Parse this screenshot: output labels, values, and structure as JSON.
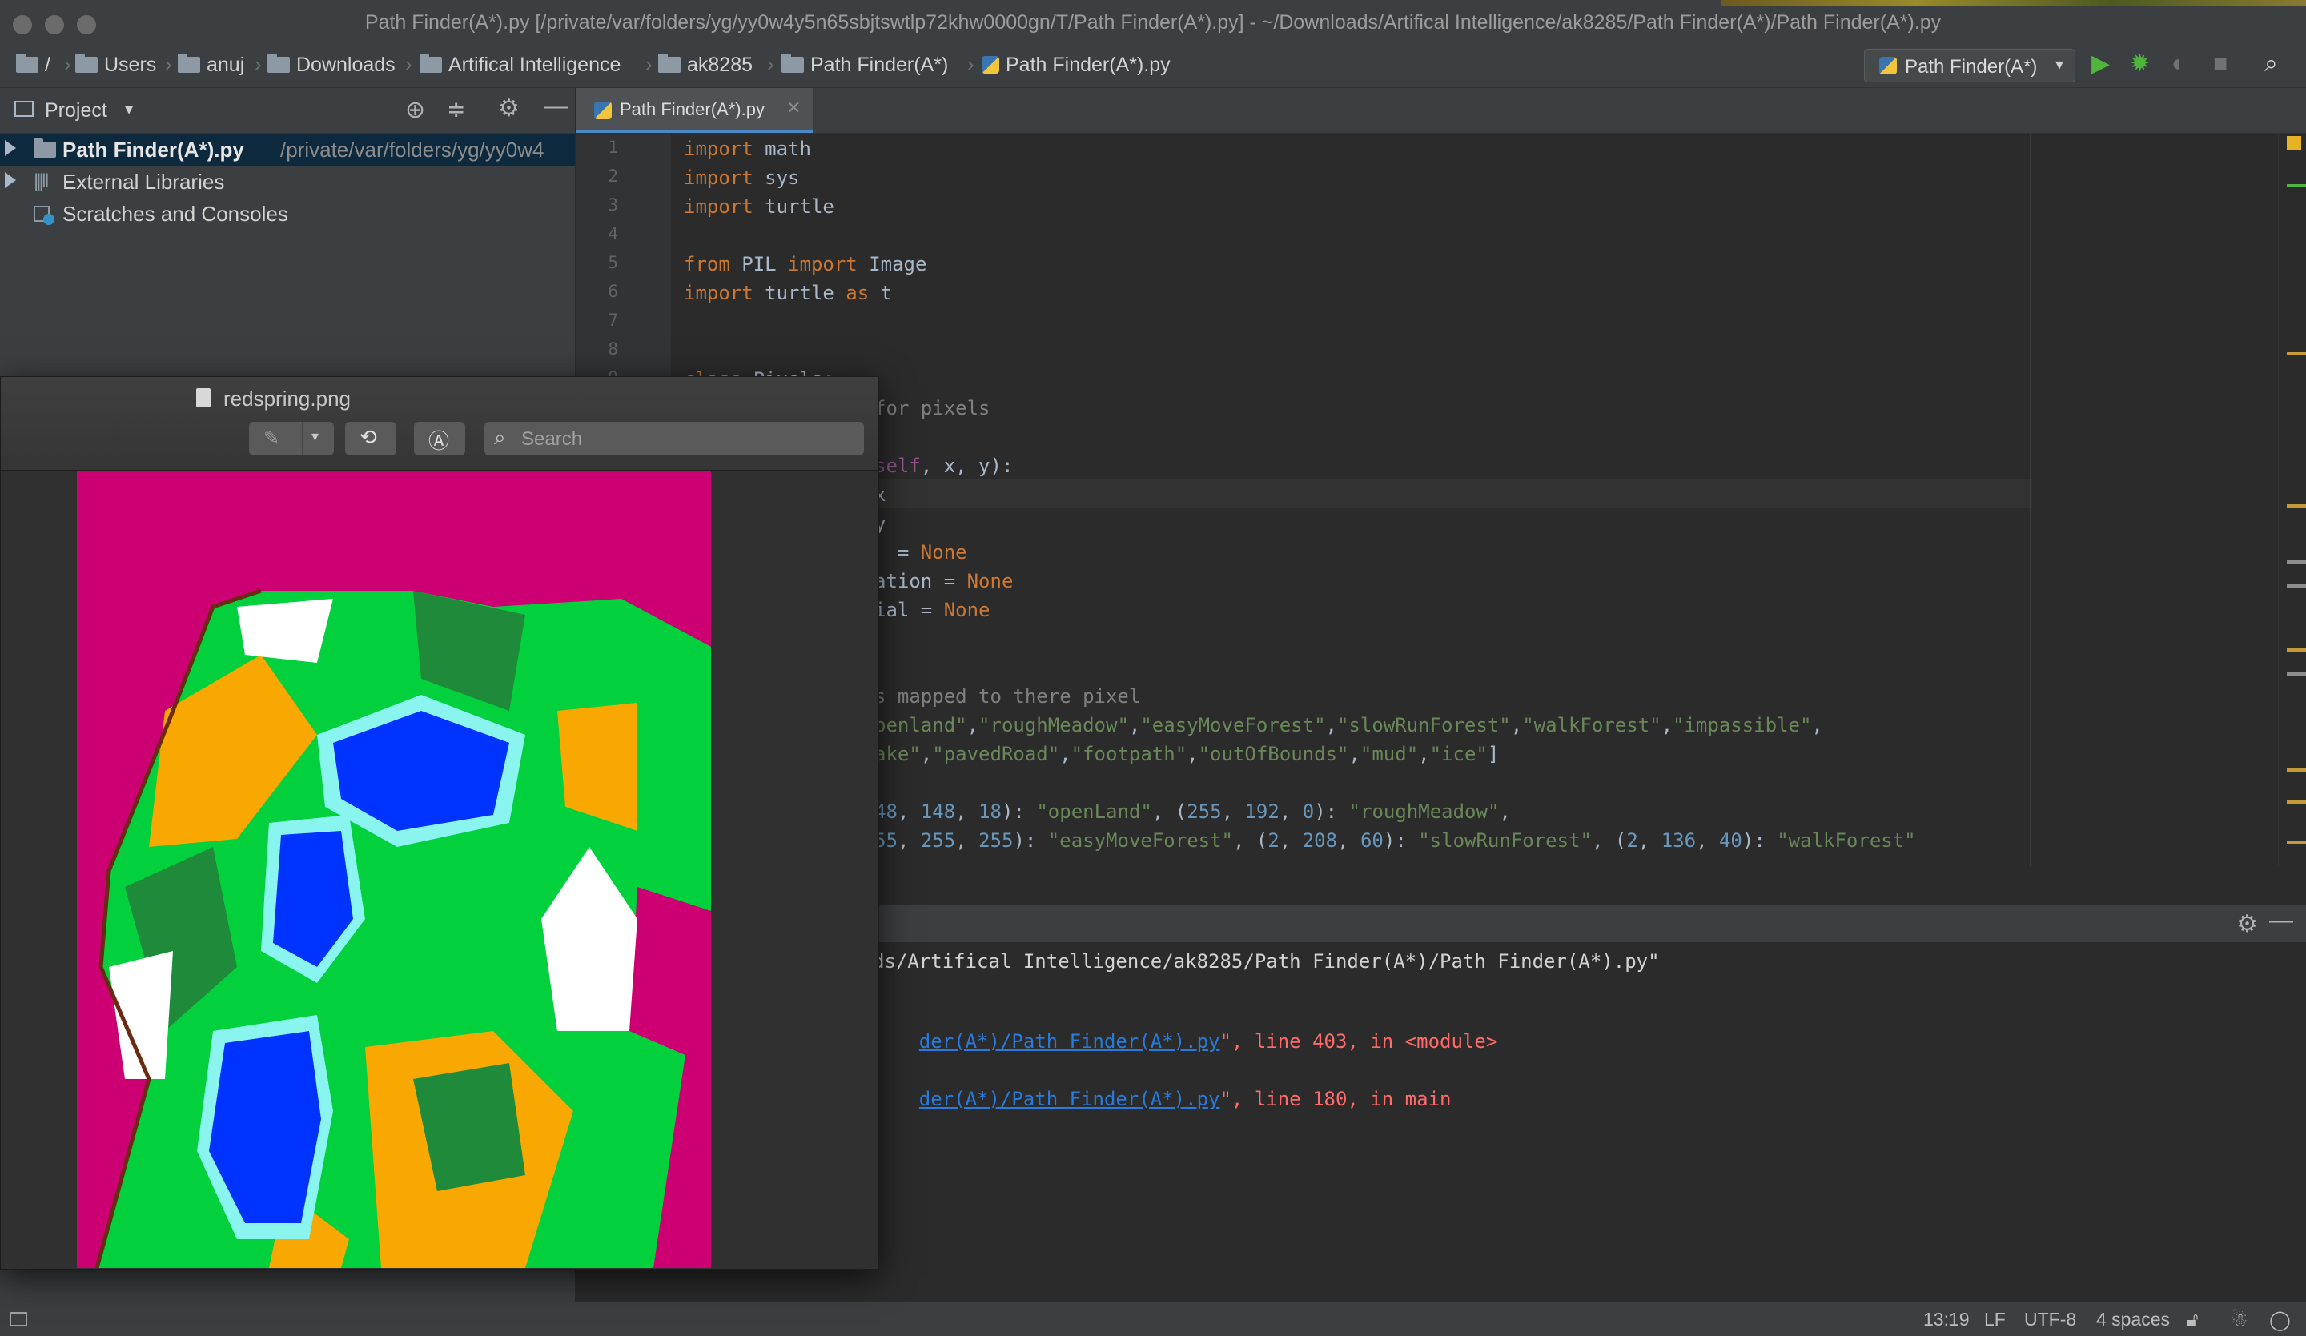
{
  "window": {
    "title": "Path Finder(A*).py [/private/var/folders/yg/yy0w4y5n65sbjtswtlp72khw0000gn/T/Path Finder(A*).py] - ~/Downloads/Artifical Intelligence/ak8285/Path Finder(A*)/Path Finder(A*).py"
  },
  "breadcrumbs": {
    "root": "/",
    "items": [
      "Users",
      "anuj",
      "Downloads",
      "Artifical Intelligence",
      "ak8285",
      "Path Finder(A*)",
      "Path Finder(A*).py"
    ]
  },
  "toolbar": {
    "run_config": "Path Finder(A*)",
    "icons": [
      "run-icon",
      "debug-icon",
      "coverage-icon",
      "stop-icon",
      "search-icon"
    ]
  },
  "project_panel": {
    "title": "Project",
    "tree": [
      {
        "label": "Path Finder(A*).py",
        "path": "/private/var/folders/yg/yy0w4"
      },
      {
        "label": "External Libraries"
      },
      {
        "label": "Scratches and Consoles"
      }
    ]
  },
  "editor": {
    "tab": "Path Finder(A*).py",
    "line_numbers": [
      "1",
      "2",
      "3",
      "4",
      "5",
      "6",
      "7",
      "8",
      "9"
    ]
  },
  "image_viewer": {
    "filename": "redspring.png",
    "search_placeholder": "Search",
    "colors": {
      "out_of_bounds": "#cd0073",
      "water": "#0033ff",
      "ice": "#8af5ef",
      "forest_light": "#ffffff",
      "forest_walk": "#1e8a3a",
      "slow_run": "#02d03c",
      "open_land": "#f8a800"
    }
  },
  "run_output": {
    "line1": "ds/Artifical Intelligence/ak8285/Path Finder(A*)/Path Finder(A*).py\"",
    "link": "der(A*)/Path Finder(A*).py",
    "err1": "\", line 403, in <module>",
    "err2": "\", line 180, in main"
  },
  "statusbar": {
    "position": "13:19",
    "line_sep": "LF",
    "encoding": "UTF-8",
    "indent": "4 spaces"
  }
}
